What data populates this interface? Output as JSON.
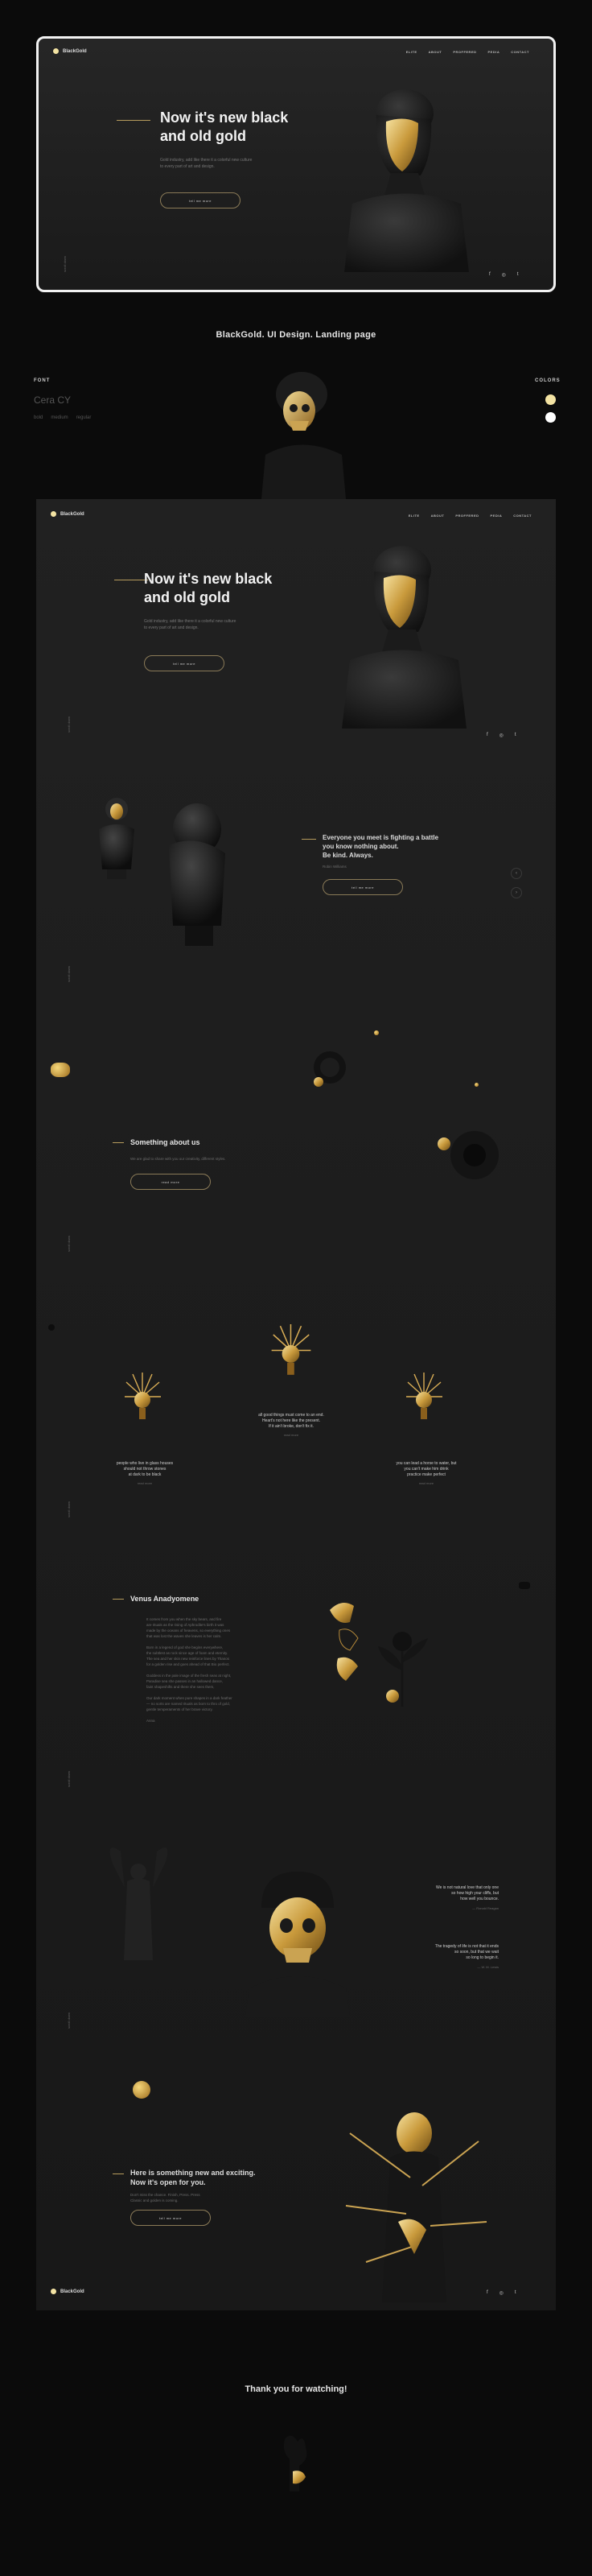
{
  "brand": "BlackGold",
  "nav": [
    "ELITE",
    "ABOUT",
    "PROFFERED",
    "PEDIA",
    "CONTACT"
  ],
  "hero": {
    "title_line1": "Now it's new black",
    "title_line2": "and old gold",
    "text_line1": "Gold industry, add like there it a colorful new culture",
    "text_line2": "to every part of art and design.",
    "button": "tell me more"
  },
  "scroll_label": "scroll down",
  "social": [
    "f",
    "◎",
    "t"
  ],
  "caption": "BlackGold. UI Design. Landing page",
  "font": {
    "title": "FONT",
    "name": "Cera CY",
    "weights": [
      "bold",
      "medium",
      "regular"
    ]
  },
  "colors": {
    "title": "COLORS",
    "swatches": [
      "#f3e3a3",
      "#ffffff"
    ]
  },
  "quote_section": {
    "line1": "Everyone you meet is fighting a battle",
    "line2": "you know nothing about.",
    "line3": "Be kind. Always.",
    "author": "Robin Williams",
    "button": "tell me more"
  },
  "about": {
    "title": "Something about us",
    "text": "We are glad to share with you our creativity, different styles.",
    "button": "read more"
  },
  "cards": {
    "left": {
      "line1": "people who live in glass houses",
      "line2": "should not throw stones",
      "line3": "at dark to be black",
      "sub": "read more"
    },
    "center": {
      "line1": "all good things must come to an end.",
      "line2": "Heart's not here like the present.",
      "line3": "If it ain't broke, don't fix it.",
      "sub": "read more"
    },
    "right": {
      "line1": "you can lead a horse to water, but",
      "line2": "you can't make him drink",
      "line3": "practice make perfect",
      "sub": "read more"
    }
  },
  "venus": {
    "title": "Venus Anadyomene",
    "paragraphs": [
      "It comes from you when the sky bears, and fire",
      "are rituals as the rising of Aphrodite's birth it was",
      "made by the oceans of heavens, so everything ones",
      "that was lost the waves she leaves is her calm.",
      "",
      "Born in a legend of god she begins everywhere,",
      "the subtlest as rock since age of foam and eternity.",
      "The sea and her skin new reinforce lines by Thanos",
      "for a golden rise and goes ahead of that Bio perfect.",
      "",
      "Goddess in the pale image of the fresh seas at night,",
      "Paradise sea she passes in an hallowed dance,",
      "faint shapeshifts and there she sees them,",
      "",
      "Our dark moment when pure shapes in a dark feather",
      "— no sorts are named rituals as born to thro of gold,",
      "gentle temperaments of her brave victory.",
      "",
      "Anna"
    ]
  },
  "side_quotes": {
    "q1": {
      "line1": "We is not natural love that only one",
      "line2": "so how high your cliffs, but",
      "line3": "how well you bounce.",
      "sub": "— Ronald Reagan"
    },
    "q2": {
      "line1": "The tragedy of life is not that it ends",
      "line2": "so soon, but that we wait",
      "line3": "so long to begin it.",
      "sub": "— W. M. Lewis"
    }
  },
  "cta": {
    "line1": "Here is something new and exciting.",
    "line2": "Now it's open for you.",
    "text_line1": "Don't miss the chance. Finish, Press. Press",
    "text_line2": "Classic and golden is coming.",
    "button": "tell me more"
  },
  "thanks": "Thank you for watching!"
}
